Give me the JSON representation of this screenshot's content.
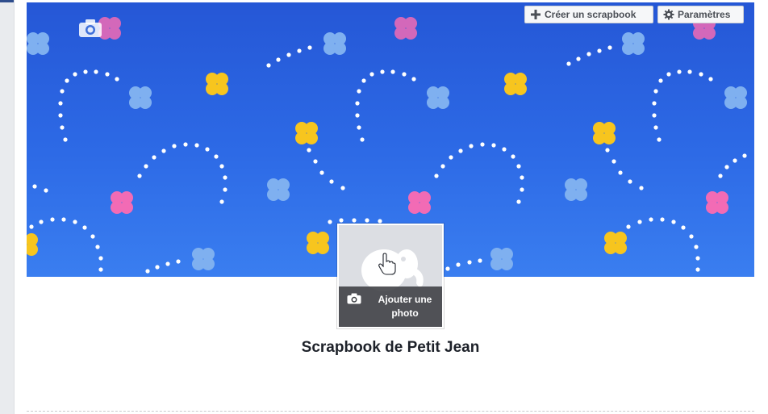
{
  "toolbar": {
    "create_label": "Créer un scrapbook",
    "create_icon": "plus-icon",
    "settings_label": "Paramètres",
    "settings_icon": "gear-icon"
  },
  "cover": {
    "camera_icon": "camera-icon",
    "colors": {
      "top": "#2557d6",
      "bottom": "#3a7ef0",
      "flower_yellow": "#f7c51e",
      "flower_pink": "#f26bb5",
      "flower_blue": "#7fb0f0",
      "dots": "#ffffff"
    }
  },
  "profile": {
    "add_photo_label": "Ajouter une photo",
    "add_photo_icon": "camera-icon",
    "placeholder_icon": "elephant-icon"
  },
  "scrapbook": {
    "title": "Scrapbook de Petit Jean"
  }
}
